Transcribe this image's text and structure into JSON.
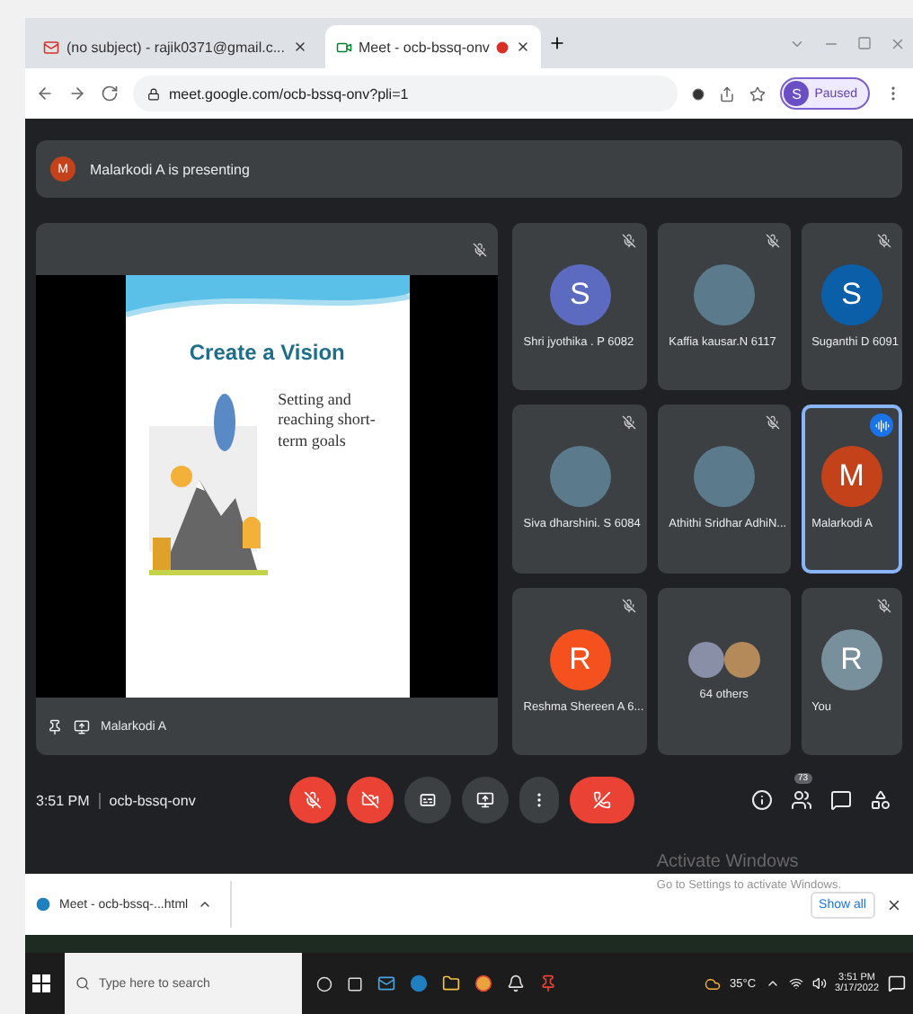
{
  "browser": {
    "tabs": [
      {
        "title": "(no subject) - rajik0371@gmail.c...",
        "kind": "mail",
        "selected": false,
        "recording": false
      },
      {
        "title": "Meet - ocb-bssq-onv",
        "kind": "meet",
        "selected": true,
        "recording": true
      }
    ],
    "address": "meet.google.com/ocb-bssq-onv?pli=1",
    "profile": {
      "initial": "S",
      "label": "Paused"
    }
  },
  "meet": {
    "banner": {
      "initial": "M",
      "text": "Malarkodi A is presenting"
    },
    "stage": {
      "slide_title": "Create a Vision",
      "slide_bullet": "Setting and reaching short-term goals",
      "presenter": "Malarkodi A"
    },
    "participants": [
      {
        "kind": "initial",
        "name": "Shri jyothika . P 6082",
        "initial": "S",
        "color": "#5c6bc0",
        "muted": true,
        "selected": false
      },
      {
        "kind": "photo",
        "name": "Kaffia kausar.N 6117",
        "muted": true,
        "selected": false
      },
      {
        "kind": "initial",
        "name": "Suganthi D 6091",
        "initial": "S",
        "color": "#0b5ea8",
        "muted": true,
        "selected": false
      },
      {
        "kind": "photo",
        "name": "Siva dharshini. S 6084",
        "muted": true,
        "selected": false
      },
      {
        "kind": "photo",
        "name": "Athithi Sridhar AdhiN...",
        "muted": true,
        "selected": false
      },
      {
        "kind": "initial",
        "name": "Malarkodi A",
        "initial": "M",
        "color": "#c4421a",
        "muted": false,
        "selected": true
      },
      {
        "kind": "initial",
        "name": "Reshma Shereen A 6...",
        "initial": "R",
        "color": "#f4511e",
        "muted": true,
        "selected": false
      },
      {
        "kind": "others",
        "name": "64 others",
        "muted": false,
        "selected": false
      },
      {
        "kind": "initial",
        "name": "You",
        "initial": "R",
        "color": "#78909c",
        "muted": true,
        "selected": false
      }
    ],
    "toolbar": {
      "time": "3:51 PM",
      "code": "ocb-bssq-onv",
      "controls": [
        {
          "kind": "mic",
          "off": true
        },
        {
          "kind": "camera",
          "off": true
        },
        {
          "kind": "captions",
          "off": false
        },
        {
          "kind": "present",
          "off": false
        },
        {
          "kind": "more",
          "off": false
        },
        {
          "kind": "hangup"
        }
      ],
      "people_count": "73"
    }
  },
  "downloads": {
    "file": "Meet - ocb-bssq-...html",
    "show_all": "Show all"
  },
  "activation": {
    "title": "Activate Windows",
    "hint": "Go to Settings to activate Windows."
  },
  "taskbar": {
    "search_placeholder": "Type here to search",
    "weather": "35°C",
    "time": "3:51 PM",
    "date": "3/17/2022"
  }
}
